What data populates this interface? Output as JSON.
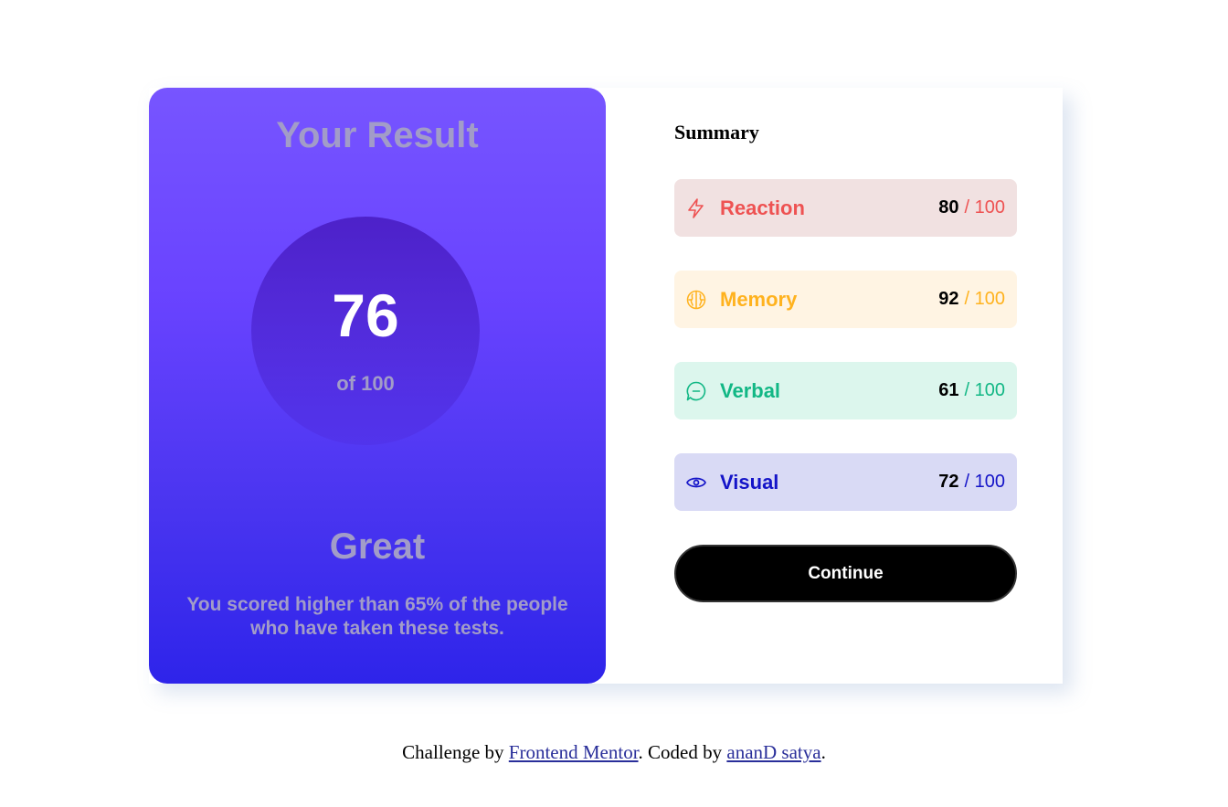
{
  "result": {
    "title": "Your Result",
    "score": "76",
    "score_total": "of 100",
    "rating": "Great",
    "description": "You scored higher than 65% of the people who have taken these tests."
  },
  "summary": {
    "title": "Summary",
    "items": [
      {
        "label": "Reaction",
        "score": "80",
        "total": "/ 100",
        "icon": "lightning-icon",
        "color": "#ee5252",
        "background": "#f1e1e1"
      },
      {
        "label": "Memory",
        "score": "92",
        "total": "/ 100",
        "icon": "brain-icon",
        "color": "#ffb21e",
        "background": "#fff4e3"
      },
      {
        "label": "Verbal",
        "score": "61",
        "total": "/ 100",
        "icon": "chat-bubble-icon",
        "color": "#12b785",
        "background": "#dcf6ed"
      },
      {
        "label": "Visual",
        "score": "72",
        "total": "/ 100",
        "icon": "eye-icon",
        "color": "#1414c8",
        "background": "#d9daf5"
      }
    ],
    "continue_label": "Continue"
  },
  "footer": {
    "prefix": "Challenge by ",
    "link1": "Frontend Mentor",
    "middle": ". Coded by ",
    "link2": "ananD satya",
    "suffix": "."
  }
}
